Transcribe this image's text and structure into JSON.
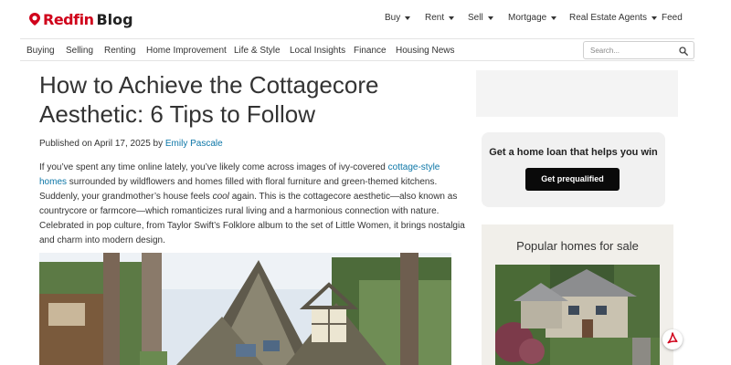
{
  "brand": {
    "name": "Redfin",
    "suffix": "Blog",
    "color": "#d0021b"
  },
  "top_nav": [
    {
      "label": "Buy",
      "dropdown": true
    },
    {
      "label": "Rent",
      "dropdown": true
    },
    {
      "label": "Sell",
      "dropdown": true
    },
    {
      "label": "Mortgage",
      "dropdown": true
    },
    {
      "label": "Real Estate Agents",
      "dropdown": true
    },
    {
      "label": "Feed",
      "dropdown": false
    }
  ],
  "sub_nav": [
    "Buying",
    "Selling",
    "Renting",
    "Home Improvement",
    "Life & Style",
    "Local Insights",
    "Finance",
    "Housing News"
  ],
  "search": {
    "placeholder": "Search...",
    "icon": "search-icon"
  },
  "article": {
    "title": "How to Achieve the Cottagecore Aesthetic: 6 Tips to Follow",
    "published_prefix": "Published on April 17, 2025 by ",
    "author": "Emily Pascale",
    "intro": {
      "l1_pre": "If you’ve spent any time online lately, you’ve likely come across images of ivy-covered ",
      "l1_link": "cottage-style",
      "l2_link": "homes",
      "l2_post": " surrounded by wildflowers and homes filled with floral furniture and green-themed kitchens.",
      "l3_pre": "Suddenly, your grandmother’s house feels ",
      "l3_em": "cool",
      "l3_post": " again. This is the cottagecore aesthetic—also known as",
      "l4": "countrycore or farmcore—which romanticizes rural living and a harmonious connection with nature.",
      "l5": "Celebrated in pop culture, from Taylor Swift’s Folklore album to the set of Little Women, it brings nostalgia",
      "l6": "and charm into modern design."
    },
    "link_color": "#0c76a7"
  },
  "sidebar": {
    "loan_card": {
      "title": "Get a home loan that helps you win",
      "button": "Get prequalified"
    },
    "homes_card": {
      "title": "Popular homes for sale"
    }
  },
  "floating": {
    "icon": "pdf-icon",
    "color": "#d0021b"
  }
}
